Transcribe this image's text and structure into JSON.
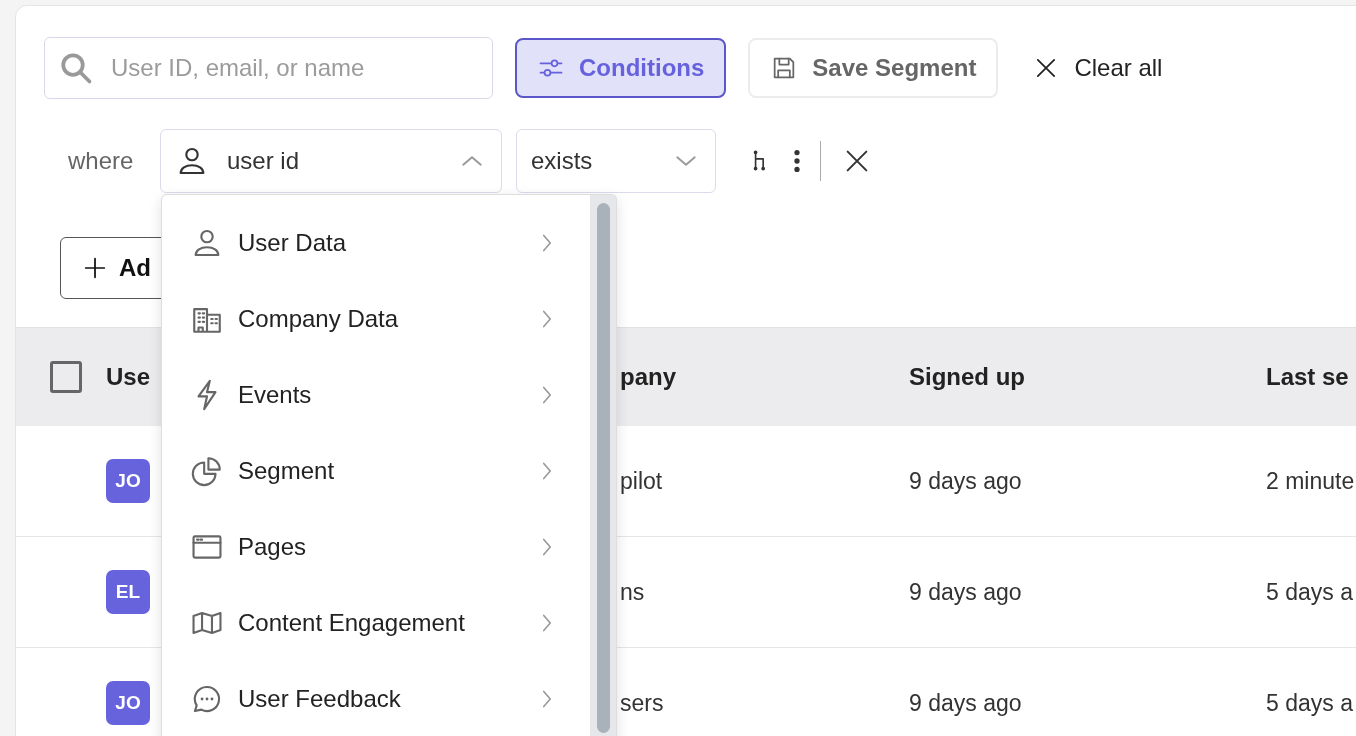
{
  "search": {
    "placeholder": "User ID, email, or name"
  },
  "toolbar_buttons": [
    {
      "kind": "conditions",
      "label": "Conditions",
      "selected": true
    },
    {
      "kind": "save",
      "label": "Save Segment",
      "selected": false
    },
    {
      "kind": "clear",
      "label": "Clear all",
      "selected": false
    }
  ],
  "condition": {
    "prefix": "where",
    "field": {
      "value": "user id",
      "expanded": true
    },
    "operator": {
      "value": "exists",
      "expanded": false
    }
  },
  "add_button": {
    "label": "Ad"
  },
  "table": {
    "header_checkbox": {
      "checked": false
    },
    "columns": [
      "Use",
      "pany",
      "Signed up",
      "Last se"
    ],
    "rows": [
      {
        "avatar": "JO",
        "company": "pilot",
        "signed_up": "9 days ago",
        "last_seen": "2 minute"
      },
      {
        "avatar": "EL",
        "company": "ns",
        "signed_up": "9 days ago",
        "last_seen": "5 days a"
      },
      {
        "avatar": "JO",
        "company": "sers",
        "signed_up": "9 days ago",
        "last_seen": "5 days a"
      }
    ]
  },
  "dropdown": {
    "items": [
      {
        "kind": "user",
        "label": "User Data"
      },
      {
        "kind": "company",
        "label": "Company Data"
      },
      {
        "kind": "events",
        "label": "Events"
      },
      {
        "kind": "segment",
        "label": "Segment"
      },
      {
        "kind": "pages",
        "label": "Pages"
      },
      {
        "kind": "content",
        "label": "Content Engagement"
      },
      {
        "kind": "feedback",
        "label": "User Feedback"
      }
    ]
  }
}
